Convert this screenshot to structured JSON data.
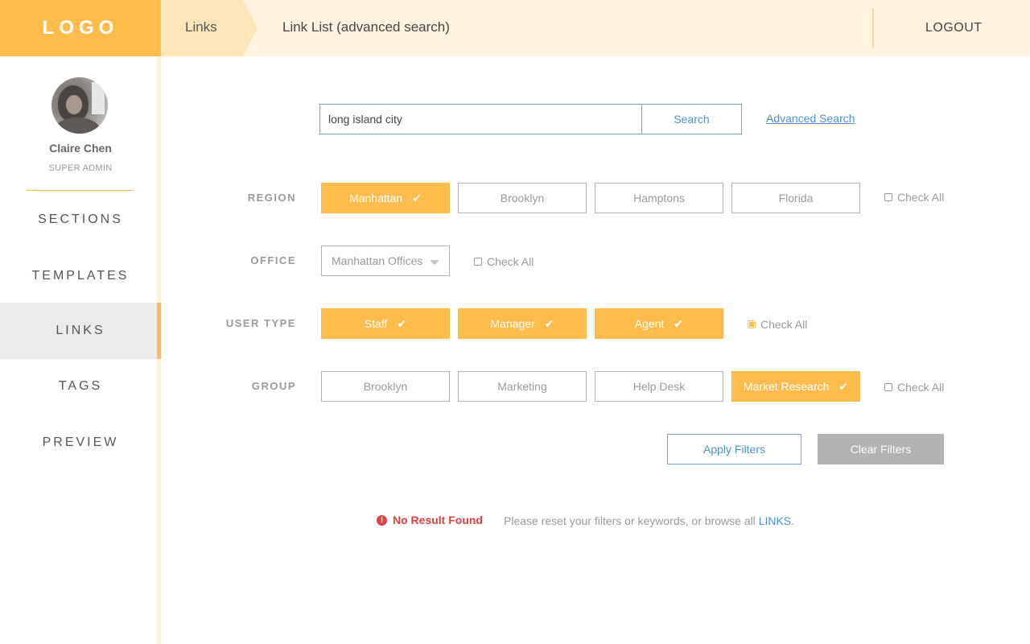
{
  "brand": {
    "logo_text": "LOGO"
  },
  "header": {
    "breadcrumb": "Links",
    "title": "Link List (advanced search)",
    "logout_label": "LOGOUT"
  },
  "user": {
    "name": "Claire Chen",
    "role": "SUPER ADMIN"
  },
  "nav": {
    "items": [
      {
        "label": "SECTIONS"
      },
      {
        "label": "TEMPLATES"
      },
      {
        "label": "LINKS",
        "active": true
      },
      {
        "label": "TAGS"
      },
      {
        "label": "PREVIEW"
      }
    ]
  },
  "search": {
    "value": "long island city",
    "button_label": "Search",
    "advanced_link": "Advanced Search"
  },
  "filters": {
    "check_all_label": "Check All",
    "region": {
      "label": "REGION",
      "options": [
        {
          "label": "Manhattan",
          "selected": true
        },
        {
          "label": "Brooklyn",
          "selected": false
        },
        {
          "label": "Hamptons",
          "selected": false
        },
        {
          "label": "Florida",
          "selected": false
        }
      ],
      "check_all": false
    },
    "office": {
      "label": "OFFICE",
      "selected_value": "Manhattan Offices",
      "check_all": false
    },
    "user_type": {
      "label": "USER TYPE",
      "options": [
        {
          "label": "Staff",
          "selected": true
        },
        {
          "label": "Manager",
          "selected": true
        },
        {
          "label": "Agent",
          "selected": true
        }
      ],
      "check_all": true
    },
    "group": {
      "label": "GROUP",
      "options": [
        {
          "label": "Brooklyn",
          "selected": false
        },
        {
          "label": "Marketing",
          "selected": false
        },
        {
          "label": "Help Desk",
          "selected": false
        },
        {
          "label": "Market Research",
          "selected": true
        }
      ],
      "check_all": false
    }
  },
  "actions": {
    "apply_label": "Apply Filters",
    "clear_label": "Clear Filters"
  },
  "result": {
    "error_icon": "exclamation-circle-icon",
    "no_result": "No Result Found",
    "reset_message": "Please reset your filters or keywords, or browse all",
    "links_label": "LINKS",
    "trailing": "."
  },
  "colors": {
    "accent": "#fdbc4b",
    "header_bg": "#fff4e0",
    "link_blue": "#4a90d9",
    "error_red": "#e04040",
    "muted_gray": "#b3b3b3"
  }
}
